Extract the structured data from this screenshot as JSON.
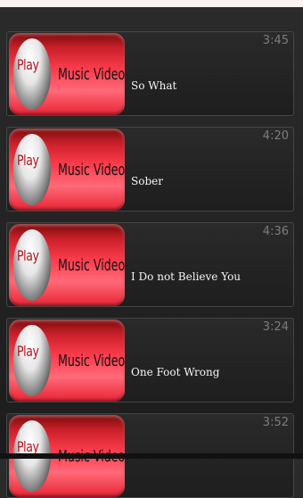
{
  "videos": [
    {
      "thumb_play": "Play",
      "thumb_caption": "Music Video",
      "duration": "3:45",
      "title": "So What"
    },
    {
      "thumb_play": "Play",
      "thumb_caption": "Music Video",
      "duration": "4:20",
      "title": "Sober"
    },
    {
      "thumb_play": "Play",
      "thumb_caption": "Music Video",
      "duration": "4:36",
      "title": "I Do not Believe You"
    },
    {
      "thumb_play": "Play",
      "thumb_caption": "Music Video",
      "duration": "3:24",
      "title": "One Foot Wrong"
    },
    {
      "thumb_play": "Play",
      "thumb_caption": "Music Video",
      "duration": "3:52",
      "title": ""
    }
  ],
  "colors": {
    "background": "#222222",
    "thumb_red": "#ff3d4d",
    "duration_text": "#7c7c7c",
    "title_text": "#f5f5f5"
  },
  "icons": [
    "play-disc-icon"
  ]
}
